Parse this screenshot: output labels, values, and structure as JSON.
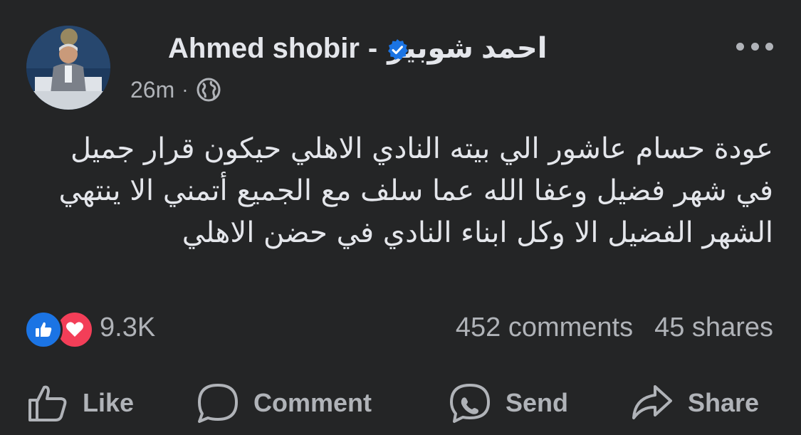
{
  "post": {
    "author_latin": "Ahmed shobir",
    "author_separator": "-",
    "author_arabic": "احمد شوبير",
    "time_ago": "26m",
    "meta_separator": "·",
    "audience_icon": "globe-icon",
    "verified_icon": "verified-badge-icon",
    "more_icon": "more-options-icon",
    "body": "عودة حسام عاشور الي بيته النادي الاهلي حيكون قرار جميل في شهر فضيل وعفا الله عما سلف مع الجميع أتمني الا ينتهي الشهر الفضيل الا وكل ابناء النادي في حضن الاهلي"
  },
  "reactions": {
    "icons": [
      "like-reaction-icon",
      "love-reaction-icon"
    ],
    "count": "9.3K"
  },
  "stats": {
    "comments": "452 comments",
    "shares": "45 shares"
  },
  "actions": {
    "like": {
      "label": "Like",
      "icon": "thumbs-up-icon"
    },
    "comment": {
      "label": "Comment",
      "icon": "comment-bubble-icon"
    },
    "send": {
      "label": "Send",
      "icon": "messenger-icon"
    },
    "share": {
      "label": "Share",
      "icon": "share-arrow-icon"
    }
  },
  "colors": {
    "background": "#242526",
    "primary_text": "#e4e6eb",
    "secondary_text": "#b0b3b8",
    "like_blue": "#1b74e4",
    "love_red": "#f33e58"
  }
}
